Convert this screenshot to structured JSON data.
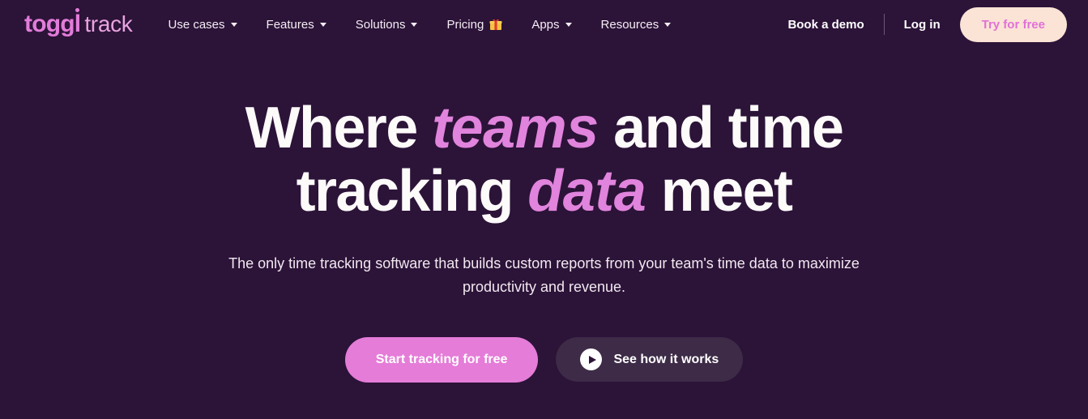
{
  "theme": {
    "background": "#2C1338",
    "accent_pink": "#E184DD",
    "button_pink": "#E57CD8",
    "cream": "#FBE3D6",
    "text_white": "#FDFAFA",
    "secondary_button": "#3D2B47"
  },
  "nav": {
    "logo": {
      "primary": "toggl",
      "secondary": "track"
    },
    "links": [
      {
        "label": "Use cases",
        "has_dropdown": true,
        "icon": "chevron-down-icon"
      },
      {
        "label": "Features",
        "has_dropdown": true,
        "icon": "chevron-down-icon"
      },
      {
        "label": "Solutions",
        "has_dropdown": true,
        "icon": "chevron-down-icon"
      },
      {
        "label": "Pricing",
        "has_dropdown": false,
        "icon": "gift-icon"
      },
      {
        "label": "Apps",
        "has_dropdown": true,
        "icon": "chevron-down-icon"
      },
      {
        "label": "Resources",
        "has_dropdown": true,
        "icon": "chevron-down-icon"
      }
    ],
    "book_demo": "Book a demo",
    "log_in": "Log in",
    "try_free": "Try for free"
  },
  "hero": {
    "headline": {
      "line1_part1": "Where ",
      "line1_accent": "teams",
      "line1_part2": " and time",
      "line2_part1": "tracking ",
      "line2_accent": "data",
      "line2_part2": " meet"
    },
    "subtitle": "The only time tracking software that builds custom reports from your team's time data to maximize productivity and revenue.",
    "cta_primary": "Start tracking for free",
    "cta_secondary": "See how it works",
    "cta_secondary_icon": "play-icon"
  }
}
